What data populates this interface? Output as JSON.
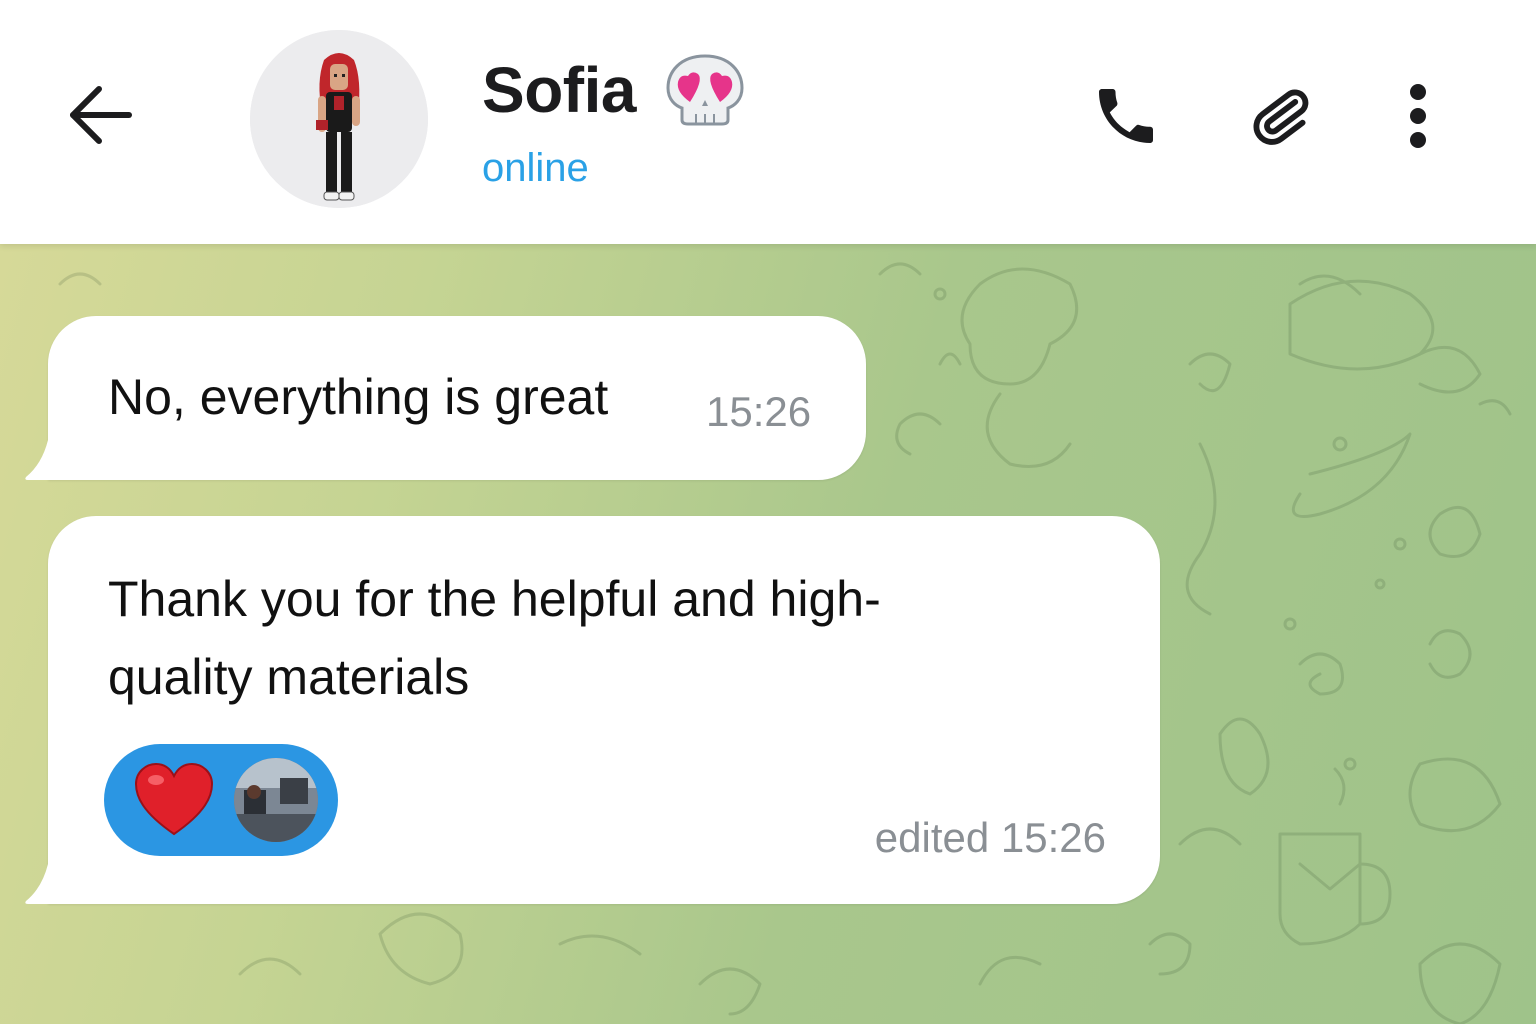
{
  "header": {
    "back_icon": "arrow-left-icon",
    "contact_name": "Sofia",
    "status_emoji": "skull-with-heart-eyes-emoji",
    "status_text": "online",
    "actions": {
      "call_icon": "phone-icon",
      "attach_icon": "paperclip-icon",
      "more_icon": "vertical-dots-icon"
    }
  },
  "messages": [
    {
      "text": "No, everything is great",
      "time": "15:26",
      "direction": "incoming"
    },
    {
      "text": "Thank you for the helpful and high-quality materials",
      "time": "edited 15:26",
      "direction": "incoming",
      "reaction": {
        "emoji": "heart-emoji",
        "reactor": "reactor-avatar"
      }
    }
  ],
  "colors": {
    "accent": "#2aa1e6",
    "reaction_bg": "#2b96e3",
    "bubble": "#ffffff",
    "time_text": "#8a8f94",
    "wallpaper_left": "#d6d998",
    "wallpaper_right": "#9fc38a"
  }
}
